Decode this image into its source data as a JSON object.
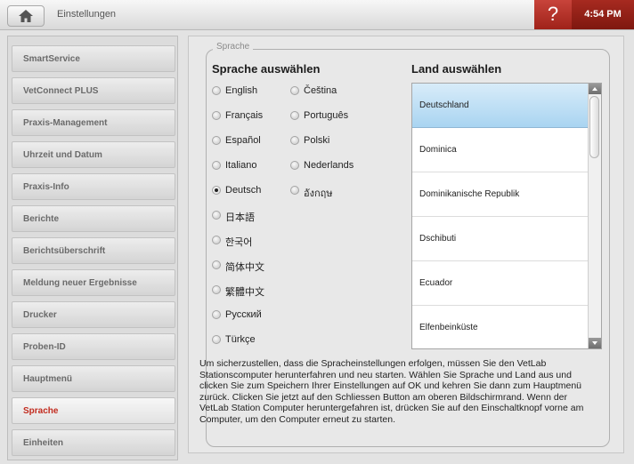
{
  "topbar": {
    "title": "Einstellungen",
    "help_label": "?",
    "time": "4:54 PM",
    "home_icon": "home-icon"
  },
  "sidebar": {
    "items": [
      {
        "label": "SmartService",
        "active": false
      },
      {
        "label": "VetConnect PLUS",
        "active": false
      },
      {
        "label": "Praxis-Management",
        "active": false
      },
      {
        "label": "Uhrzeit und Datum",
        "active": false
      },
      {
        "label": "Praxis-Info",
        "active": false
      },
      {
        "label": "Berichte",
        "active": false
      },
      {
        "label": "Berichtsüberschrift",
        "active": false
      },
      {
        "label": "Meldung neuer Ergebnisse",
        "active": false
      },
      {
        "label": "Drucker",
        "active": false
      },
      {
        "label": "Proben-ID",
        "active": false
      },
      {
        "label": "Hauptmenü",
        "active": false
      },
      {
        "label": "Sprache",
        "active": true
      },
      {
        "label": "Einheiten",
        "active": false
      }
    ]
  },
  "panel": {
    "legend": "Sprache",
    "language_heading": "Sprache auswählen",
    "country_heading": "Land auswählen",
    "languages_col1": [
      "English",
      "Français",
      "Español",
      "Italiano",
      "Deutsch",
      "日本語",
      "한국어",
      "简体中文",
      "繁體中文",
      "Русский",
      "Türkçe"
    ],
    "languages_col2": [
      "Čeština",
      "Português",
      "Polski",
      "Nederlands",
      "อังกฤษ"
    ],
    "selected_language": "Deutsch",
    "countries": [
      "Deutschland",
      "Dominica",
      "Dominikanische Republik",
      "Dschibuti",
      "Ecuador",
      "Elfenbeinküste"
    ],
    "selected_country": "Deutschland",
    "info_text": "Um sicherzustellen, dass die Spracheinstellungen erfolgen, müssen Sie den VetLab Stationscomputer herunterfahren und neu starten. Wählen Sie Sprache und Land aus und clicken Sie zum Speichern Ihrer Einstellungen auf OK und kehren Sie dann zum Hauptmenü zurück. Clicken Sie jetzt auf den Schliessen Button am oberen Bildschirmrand. Wenn der VetLab Station Computer heruntergefahren ist, drücken Sie auf den Einschaltknopf vorne am Computer, um den Computer erneut zu starten."
  },
  "colors": {
    "accent_red": "#c22b1e",
    "selection_blue": "#a9d4f1"
  }
}
